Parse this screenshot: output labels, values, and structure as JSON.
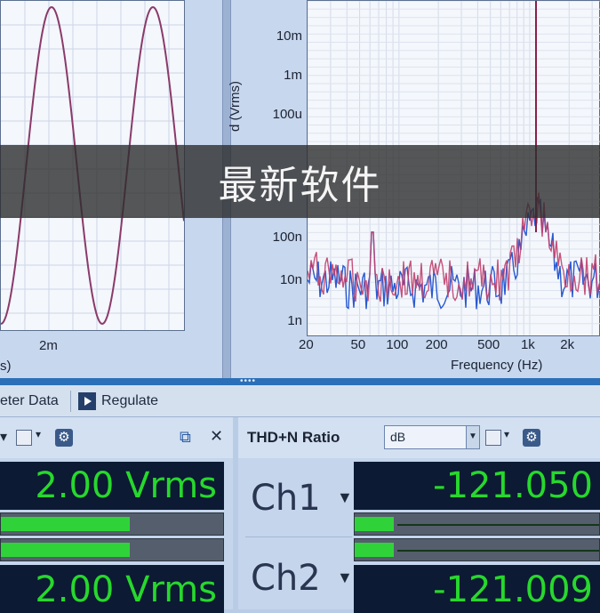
{
  "banner": {
    "text": "最新软件"
  },
  "left_graph": {
    "x_tick": "2m",
    "x_unit_fragment": "s)"
  },
  "right_graph": {
    "y_ticks": [
      "10m",
      "1m",
      "100u",
      "100n",
      "10n",
      "1n"
    ],
    "y_label_fragment": "d (Vrms)",
    "x_ticks": [
      "20",
      "50",
      "100",
      "200",
      "500",
      "1k",
      "2k"
    ],
    "x_label": "Frequency (Hz)",
    "series_colors": [
      "#2a5ad0",
      "#c0406e"
    ]
  },
  "toolbar": {
    "meter_data_label": "eter Data",
    "regulate_label": "Regulate"
  },
  "level_panel": {
    "popout_glyph": "⧉",
    "close_glyph": "✕",
    "readings": [
      {
        "value": "2.00 Vrms",
        "bar_fraction": 0.58
      },
      {
        "value": "2.00 Vrms",
        "bar_fraction": 0.58
      }
    ]
  },
  "thd_panel": {
    "title": "THD+N Ratio",
    "unit_select": "dB",
    "channels": [
      {
        "label": "Ch1",
        "value": "-121.050",
        "bar_fraction": 0.16
      },
      {
        "label": "Ch2",
        "value": "-121.009",
        "bar_fraction": 0.16
      }
    ]
  },
  "colors": {
    "readout_bg": "#0c1a33",
    "readout_text": "#27d82d",
    "accent_blue": "#2b6fb9"
  }
}
